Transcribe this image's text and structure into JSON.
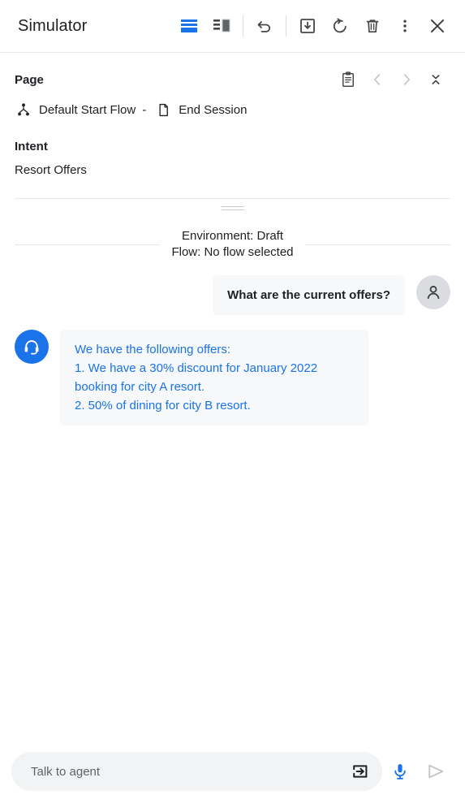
{
  "toolbar": {
    "title": "Simulator",
    "buttons": [
      {
        "name": "horizontal-split-view",
        "icon": "horizontal-split-icon",
        "state": "active"
      },
      {
        "name": "vertical-split-view",
        "icon": "vertical-split-icon",
        "state": "inactive"
      },
      {
        "name": "undo",
        "icon": "undo-icon"
      },
      {
        "name": "save",
        "icon": "save-to-box-icon"
      },
      {
        "name": "restart",
        "icon": "restart-icon"
      },
      {
        "name": "delete",
        "icon": "trash-icon"
      },
      {
        "name": "more-options",
        "icon": "more-vert-icon"
      },
      {
        "name": "close",
        "icon": "close-icon"
      }
    ]
  },
  "info": {
    "page_label": "Page",
    "flow_name": "Default Start Flow",
    "separator": "-",
    "page_name": "End Session",
    "intent_label": "Intent",
    "intent_value": "Resort Offers",
    "actions": {
      "notes": "notes-clipboard-icon",
      "previous": "chevron-left-icon",
      "next": "chevron-right-icon",
      "collapse": "collapse-icon"
    }
  },
  "conversation": {
    "session_meta_line1": "Environment: Draft",
    "session_meta_line2": "Flow: No flow selected",
    "messages": [
      {
        "author": "user",
        "avatar_icon": "person-icon",
        "text": "What are the current offers?"
      },
      {
        "author": "agent",
        "avatar_icon": "headset-icon",
        "text": "We have the following offers:\n1. We have a 30% discount for January 2022 booking for city A resort.\n2. 50% of dining for city B resort."
      }
    ]
  },
  "composer": {
    "placeholder": "Talk to agent",
    "value": "",
    "enter_icon": "enter-box-icon",
    "mic_icon": "microphone-icon",
    "send_icon": "send-icon"
  },
  "colors": {
    "accent_blue": "#1a73e8",
    "icon_gray": "#444746",
    "disabled_gray": "#bdc1c6",
    "bubble_bg": "#f6f8f9",
    "field_bg": "#f1f3f4"
  }
}
